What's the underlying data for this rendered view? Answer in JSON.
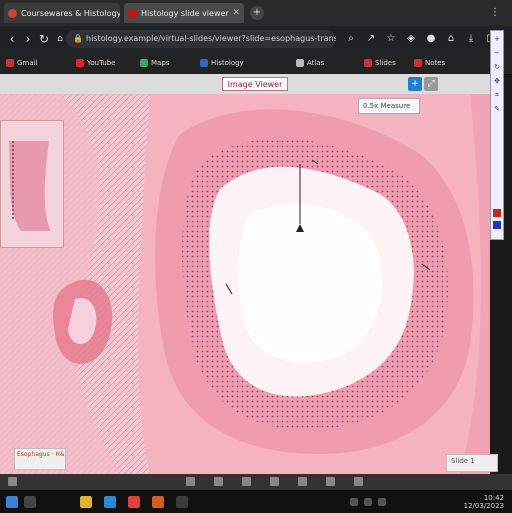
{
  "browser": {
    "tabs": [
      {
        "title": "Coursewares & Histology",
        "color": "#c44",
        "active": false
      },
      {
        "title": "Histology slide viewer",
        "color": "#c11",
        "active": true
      }
    ],
    "new_tab_icon": "plus-icon",
    "address": "histology.example/virtual-slides/viewer?slide=esophagus-transverse",
    "bookmarks": [
      {
        "label": "Gmail",
        "color": "#c33"
      },
      {
        "label": "YouTube",
        "color": "#e22"
      },
      {
        "label": "Maps",
        "color": "#3a6"
      },
      {
        "label": "Histology",
        "color": "#36c"
      },
      {
        "label": "Atlas",
        "color": "#bbb"
      },
      {
        "label": "Slides",
        "color": "#c33"
      },
      {
        "label": "Notes",
        "color": "#c33"
      }
    ]
  },
  "viewer": {
    "title": "Image Viewer",
    "info_box": "0.5x  Measure",
    "label_bottom_left": "Esophagus · H&E",
    "label_bottom_right": "Slide 1"
  },
  "taskbar": {
    "time": "10:42",
    "date": "12/03/2023"
  },
  "colors": {
    "tissue_pink": "#f0a8b8",
    "lumen": "#fdf2f4",
    "accent_blue": "#1e7fd0"
  }
}
